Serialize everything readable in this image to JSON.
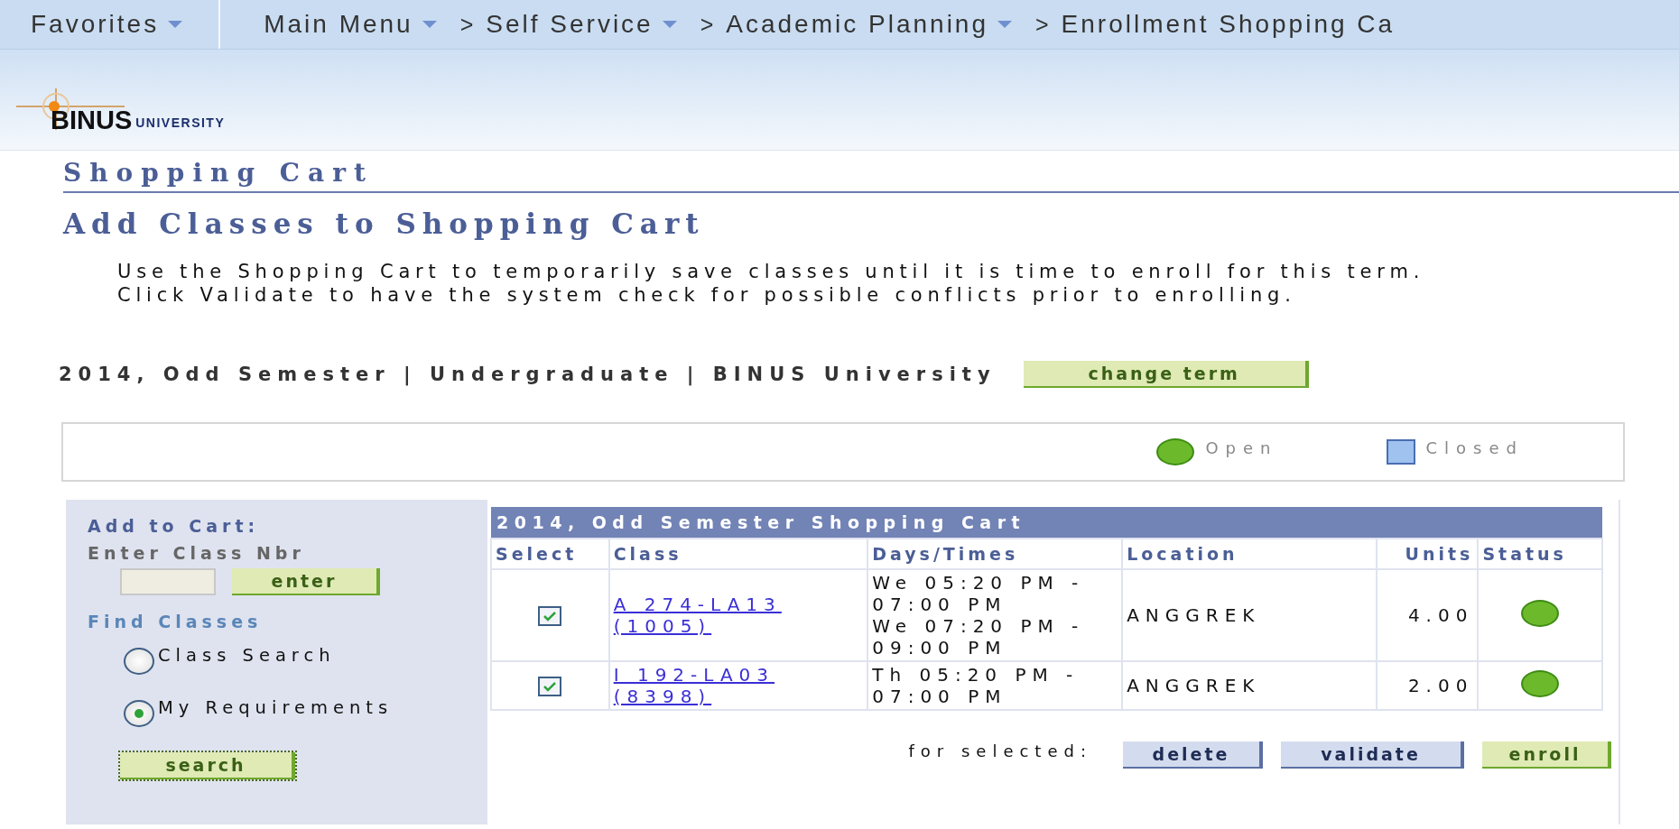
{
  "nav": {
    "items": [
      {
        "label": "Favorites",
        "dropdown": true
      },
      {
        "label": "Main Menu",
        "dropdown": true
      },
      {
        "sep": ">",
        "label": "Self Service",
        "dropdown": true
      },
      {
        "sep": ">",
        "label": "Academic Planning",
        "dropdown": true
      },
      {
        "sep": ">",
        "label": "Enrollment Shopping Ca",
        "dropdown": false
      }
    ]
  },
  "logo": {
    "name": "BINUS",
    "sub": "UNIVERSITY"
  },
  "page_title": "Shopping Cart",
  "subtitle": "Add Classes to Shopping Cart",
  "instructions": [
    "Use the Shopping Cart to temporarily save classes until it is time to enroll for this term.",
    "Click Validate to have the system check for possible conflicts prior to enrolling."
  ],
  "term": {
    "text": "2014, Odd Semester | Undergraduate | BINUS University",
    "button": "change term"
  },
  "legend": [
    {
      "kind": "open",
      "label": "Open"
    },
    {
      "kind": "closed",
      "label": "Closed"
    }
  ],
  "add_panel": {
    "title": "Add to Cart:",
    "field_label": "Enter Class Nbr",
    "enter_button": "enter",
    "find_title": "Find Classes",
    "options": [
      {
        "label": "Class Search",
        "selected": false
      },
      {
        "label": "My Requirements",
        "selected": true
      }
    ],
    "search_button": "search"
  },
  "cart": {
    "title": "2014, Odd Semester Shopping Cart",
    "columns": [
      "Select",
      "Class",
      "Days/Times",
      "Location",
      "Units",
      "Status"
    ],
    "rows": [
      {
        "checked": true,
        "class": [
          "A 274-LA13",
          "(1005)"
        ],
        "times": [
          "We 05:20 PM -",
          "07:00 PM",
          "We 07:20 PM -",
          "09:00 PM"
        ],
        "location": "ANGGREK",
        "units": "4.00",
        "open": true
      },
      {
        "checked": true,
        "class": [
          "I 192-LA03",
          "(8398)"
        ],
        "times": [
          "Th 05:20 PM -",
          "07:00 PM"
        ],
        "location": "ANGGREK",
        "units": "2.00",
        "open": true
      }
    ],
    "footer_label": "for selected:",
    "buttons": [
      {
        "label": "delete",
        "kind": "blue"
      },
      {
        "label": "validate",
        "kind": "blue"
      },
      {
        "label": "enroll",
        "kind": "green"
      }
    ]
  }
}
